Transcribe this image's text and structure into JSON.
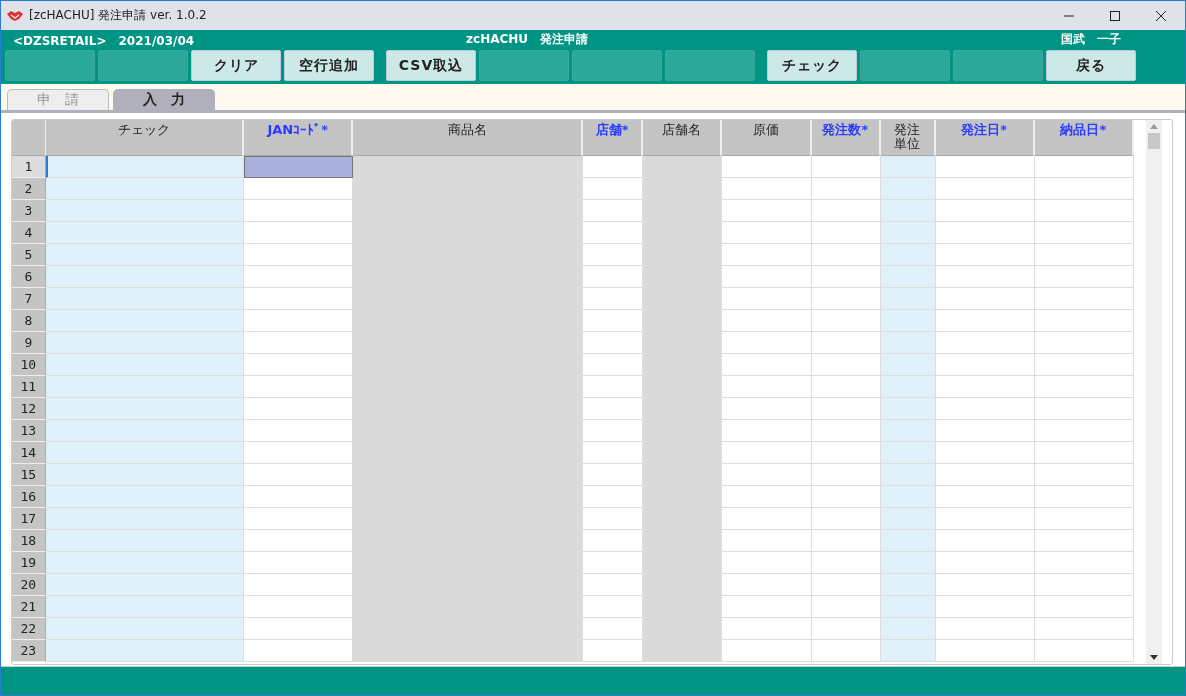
{
  "window": {
    "title": "[zcHACHU] 発注申請 ver. 1.0.2"
  },
  "header": {
    "company": "<DZSRETAIL>",
    "date": "2021/03/04",
    "screen_title": "zcHACHU　発注申請",
    "user": "国武　一子"
  },
  "toolbar": [
    {
      "kind": "blank"
    },
    {
      "kind": "blank"
    },
    {
      "kind": "action",
      "label": "クリア"
    },
    {
      "kind": "action",
      "label": "空行追加"
    },
    {
      "kind": "action",
      "label": "CSV取込"
    },
    {
      "kind": "blank"
    },
    {
      "kind": "blank"
    },
    {
      "kind": "blank"
    },
    {
      "kind": "action",
      "label": "チェック"
    },
    {
      "kind": "blank"
    },
    {
      "kind": "blank"
    },
    {
      "kind": "action",
      "label": "戻る"
    }
  ],
  "tabs": [
    {
      "label": "申　請",
      "selected": false
    },
    {
      "label": "入　力",
      "selected": true
    }
  ],
  "table": {
    "columns": [
      {
        "label": "チェック",
        "required": false,
        "kind": "tinted"
      },
      {
        "label": "JANｺｰﾄﾞ*",
        "required": true,
        "kind": "plain"
      },
      {
        "label": "商品名",
        "required": false,
        "kind": "readonly"
      },
      {
        "label": "店舗*",
        "required": true,
        "kind": "plain"
      },
      {
        "label": "店舗名",
        "required": false,
        "kind": "readonly"
      },
      {
        "label": "原価",
        "required": false,
        "kind": "plain"
      },
      {
        "label": "発注数*",
        "required": true,
        "kind": "plain"
      },
      {
        "label": "発注単位",
        "required": false,
        "kind": "tinted"
      },
      {
        "label": "発注日*",
        "required": true,
        "kind": "plain"
      },
      {
        "label": "納品日*",
        "required": true,
        "kind": "plain"
      }
    ],
    "rows": [
      {
        "number": "1",
        "selected": true
      },
      {
        "number": "2",
        "selected": false
      },
      {
        "number": "3",
        "selected": false
      },
      {
        "number": "4",
        "selected": false
      },
      {
        "number": "5",
        "selected": false
      },
      {
        "number": "6",
        "selected": false
      },
      {
        "number": "7",
        "selected": false
      },
      {
        "number": "8",
        "selected": false
      },
      {
        "number": "9",
        "selected": false
      },
      {
        "number": "10",
        "selected": false
      },
      {
        "number": "11",
        "selected": false
      },
      {
        "number": "12",
        "selected": false
      },
      {
        "number": "13",
        "selected": false
      },
      {
        "number": "14",
        "selected": false
      },
      {
        "number": "15",
        "selected": false
      },
      {
        "number": "16",
        "selected": false
      },
      {
        "number": "17",
        "selected": false
      },
      {
        "number": "18",
        "selected": false
      },
      {
        "number": "19",
        "selected": false
      },
      {
        "number": "20",
        "selected": false
      },
      {
        "number": "21",
        "selected": false
      },
      {
        "number": "22",
        "selected": false
      },
      {
        "number": "23",
        "selected": false
      }
    ]
  }
}
